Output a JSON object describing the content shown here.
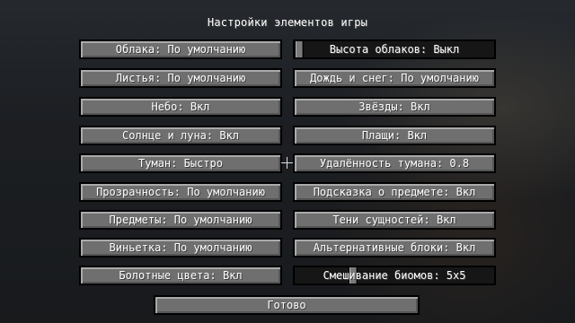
{
  "screen": {
    "title": "Настройки элементов игры"
  },
  "left_column": [
    {
      "label": "Облака: По умолчанию"
    },
    {
      "label": "Листья: По умолчанию"
    },
    {
      "label": "Небо: Вкл"
    },
    {
      "label": "Солнце и луна: Вкл"
    },
    {
      "label": "Туман: Быстро"
    },
    {
      "label": "Прозрачность: По умолчанию"
    },
    {
      "label": "Предметы: По умолчанию"
    },
    {
      "label": "Виньетка: По умолчанию"
    },
    {
      "label": "Болотные цвета: Вкл"
    }
  ],
  "right_column": [
    {
      "label": "Высота облаков: Выкл",
      "slider_value": 0.0
    },
    {
      "label": "Дождь и снег: По умолчанию"
    },
    {
      "label": "Звёзды: Вкл"
    },
    {
      "label": "Плащи: Вкл"
    },
    {
      "label": "Удалённость тумана: 0.8"
    },
    {
      "label": "Подсказка о предмете: Вкл"
    },
    {
      "label": "Тени сущностей: Вкл"
    },
    {
      "label": "Альтернативные блоки: Вкл"
    },
    {
      "label": "Смешивание биомов: 5x5",
      "slider_value": 0.33
    }
  ],
  "footer": {
    "done_label": "Готово"
  },
  "icons": {
    "crosshair": "crosshair-icon"
  }
}
